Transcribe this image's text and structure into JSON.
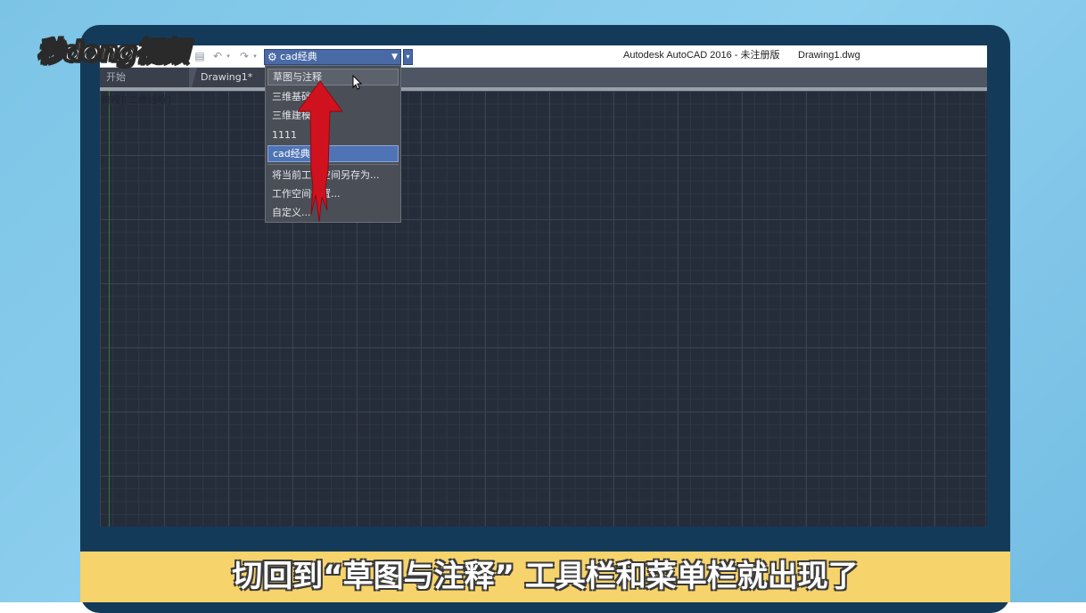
{
  "watermark": {
    "logo_text": "秒dong视频"
  },
  "titlebar": {
    "app_title": "Autodesk AutoCAD 2016 - 未注册版",
    "file_name": "Drawing1.dwg",
    "workspace_selected": "cad经典"
  },
  "tabs": [
    {
      "label": "开始"
    },
    {
      "label": "Drawing1*"
    }
  ],
  "viewport": {
    "label": "俯视][二维线框]"
  },
  "workspace_menu": {
    "items": [
      {
        "label": "草图与注释",
        "state": "hover"
      },
      {
        "label": "三维基础"
      },
      {
        "label": "三维建模"
      },
      {
        "label": "1111"
      },
      {
        "label": "cad经典",
        "state": "selected"
      },
      {
        "label": "将当前工作空间另存为..."
      },
      {
        "label": "工作空间设置..."
      },
      {
        "label": "自定义..."
      }
    ]
  },
  "subtitle": {
    "text": "切回到“草图与注释” 工具栏和菜单栏就出现了"
  },
  "colors": {
    "accent_selected": "#4f74b5",
    "arrow": "#d0121f",
    "subtitle_bar": "#f6d36b"
  }
}
